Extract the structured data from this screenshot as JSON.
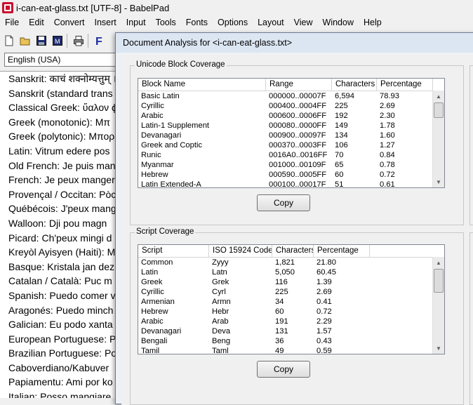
{
  "window": {
    "title": "i-can-eat-glass.txt [UTF-8] - BabelPad"
  },
  "menu": [
    "File",
    "Edit",
    "Convert",
    "Insert",
    "Input",
    "Tools",
    "Fonts",
    "Options",
    "Layout",
    "View",
    "Window",
    "Help"
  ],
  "language_combo": {
    "value": "English (USA)"
  },
  "editor_lines": [
    "Sanskrit: काचं शक्नोम्यत्तुम् । नोप",
    "Sanskrit (standard trans",
    "Classical Greek: ὕαλον ϕ",
    "Greek (monotonic): Μπ",
    "Greek (polytonic): Μπορ",
    "Latin: Vitrum edere pos",
    "Old French: Je puis man",
    "French: Je peux manger",
    "Provençal / Occitan: Pòc",
    "Québécois: J'peux mang",
    "Walloon: Dji pou magn",
    "Picard: Ch'peux mingi d",
    "Kreyòl Ayisyen (Haiti): M",
    "Basque: Kristala jan dez",
    "Catalan / Català: Puc m",
    "Spanish: Puedo comer v",
    "Aragonés: Puedo minch",
    "Galician: Eu podo xanta",
    "European Portuguese: Po",
    "Brazilian Portuguese: Po",
    "Caboverdiano/Kabuver",
    "Papiamentu: Ami por ko",
    "Italian: Posso mangiare"
  ],
  "dialog": {
    "title": "Document Analysis for <i-can-eat-glass.txt>",
    "block_group_label": "Unicode Block Coverage",
    "block_headers": [
      "Block Name",
      "Range",
      "Characters",
      "Percentage"
    ],
    "block_rows": [
      [
        "Basic Latin",
        "000000..00007F",
        "6,594",
        "78.93"
      ],
      [
        "Cyrillic",
        "000400..0004FF",
        "225",
        "2.69"
      ],
      [
        "Arabic",
        "000600..0006FF",
        "192",
        "2.30"
      ],
      [
        "Latin-1 Supplement",
        "000080..0000FF",
        "149",
        "1.78"
      ],
      [
        "Devanagari",
        "000900..00097F",
        "134",
        "1.60"
      ],
      [
        "Greek and Coptic",
        "000370..0003FF",
        "106",
        "1.27"
      ],
      [
        "Runic",
        "0016A0..0016FF",
        "70",
        "0.84"
      ],
      [
        "Myanmar",
        "001000..00109F",
        "65",
        "0.78"
      ],
      [
        "Hebrew",
        "000590..0005FF",
        "60",
        "0.72"
      ],
      [
        "Latin Extended-A",
        "000100..00017F",
        "51",
        "0.61"
      ]
    ],
    "copy_label_1": "Copy",
    "script_group_label": "Script Coverage",
    "script_headers": [
      "Script",
      "ISO 15924 Code",
      "Characters",
      "Percentage"
    ],
    "script_rows": [
      [
        "Common",
        "Zyyy",
        "1,821",
        "21.80"
      ],
      [
        "Latin",
        "Latn",
        "5,050",
        "60.45"
      ],
      [
        "Greek",
        "Grek",
        "116",
        "1.39"
      ],
      [
        "Cyrillic",
        "Cyrl",
        "225",
        "2.69"
      ],
      [
        "Armenian",
        "Armn",
        "34",
        "0.41"
      ],
      [
        "Hebrew",
        "Hebr",
        "60",
        "0.72"
      ],
      [
        "Arabic",
        "Arab",
        "191",
        "2.29"
      ],
      [
        "Devanagari",
        "Deva",
        "131",
        "1.57"
      ],
      [
        "Bengali",
        "Beng",
        "36",
        "0.43"
      ],
      [
        "Tamil",
        "Taml",
        "49",
        "0.59"
      ]
    ],
    "copy_label_2": "Copy",
    "right_stub_chars": [
      "E",
      "F",
      "N",
      "F",
      "I"
    ]
  }
}
